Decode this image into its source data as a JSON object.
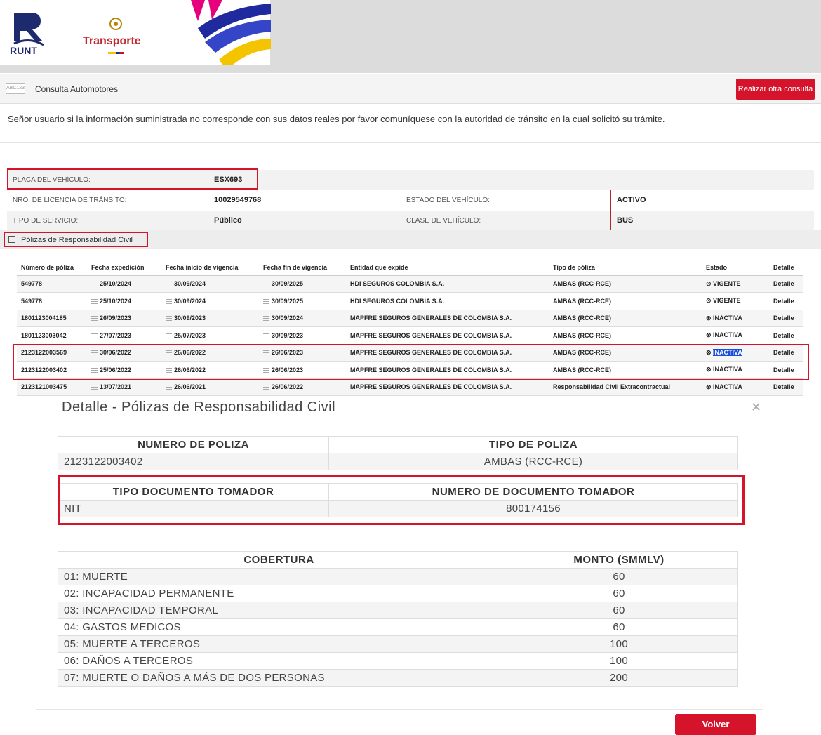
{
  "header": {
    "runt_text": "RUNT",
    "transporte_text": "Transporte"
  },
  "consulta": {
    "icon_text": "ABC123",
    "label": "Consulta Automotores",
    "button": "Realizar otra consulta"
  },
  "notice": "Señor usuario si la información suministrada no corresponde con sus datos reales por favor comuníquese con la autoridad de tránsito en la cual solicitó su trámite.",
  "vehicle": {
    "placa_label": "PLACA DEL VEHÍCULO:",
    "placa": "ESX693",
    "licencia_label": "NRO. DE LICENCIA DE TRÁNSITO:",
    "licencia": "10029549768",
    "estado_label": "ESTADO DEL VEHÍCULO:",
    "estado": "ACTIVO",
    "servicio_label": "TIPO DE SERVICIO:",
    "servicio": "Público",
    "clase_label": "CLASE DE VEHÍCULO:",
    "clase": "BUS"
  },
  "polizas": {
    "section_label": "Pólizas de Responsabilidad Civil",
    "headers": [
      "Número de póliza",
      "Fecha expedición",
      "Fecha inicio de vigencia",
      "Fecha fin de vigencia",
      "Entidad que expide",
      "Tipo de póliza",
      "Estado",
      "Detalle"
    ],
    "rows": [
      [
        "549778",
        "25/10/2024",
        "30/09/2024",
        "30/09/2025",
        "HDI SEGUROS COLOMBIA S.A.",
        "AMBAS (RCC-RCE)",
        "VIGENTE",
        "Detalle"
      ],
      [
        "549778",
        "25/10/2024",
        "30/09/2024",
        "30/09/2025",
        "HDI SEGUROS COLOMBIA S.A.",
        "AMBAS (RCC-RCE)",
        "VIGENTE",
        "Detalle"
      ],
      [
        "1801123004185",
        "26/09/2023",
        "30/09/2023",
        "30/09/2024",
        "MAPFRE SEGUROS GENERALES DE COLOMBIA S.A.",
        "AMBAS (RCC-RCE)",
        "INACTIVA",
        "Detalle"
      ],
      [
        "1801123003042",
        "27/07/2023",
        "25/07/2023",
        "30/09/2023",
        "MAPFRE SEGUROS GENERALES DE COLOMBIA S.A.",
        "AMBAS (RCC-RCE)",
        "INACTIVA",
        "Detalle"
      ],
      [
        "2123122003569",
        "30/06/2022",
        "26/06/2022",
        "26/06/2023",
        "MAPFRE SEGUROS GENERALES DE COLOMBIA S.A.",
        "AMBAS (RCC-RCE)",
        "INACTIVA",
        "Detalle"
      ],
      [
        "2123122003402",
        "25/06/2022",
        "26/06/2022",
        "26/06/2023",
        "MAPFRE SEGUROS GENERALES DE COLOMBIA S.A.",
        "AMBAS (RCC-RCE)",
        "INACTIVA",
        "Detalle"
      ],
      [
        "2123121003475",
        "13/07/2021",
        "26/06/2021",
        "26/06/2022",
        "MAPFRE SEGUROS GENERALES DE COLOMBIA S.A.",
        "Responsabilidad Civil Extracontractual",
        "INACTIVA",
        "Detalle"
      ]
    ]
  },
  "modal": {
    "title": "Detalle - Pólizas de Responsabilidad Civil",
    "close": "✕",
    "poliza_header": "NUMERO DE POLIZA",
    "poliza": "2123122003402",
    "tipo_header": "TIPO DE POLIZA",
    "tipo": "AMBAS (RCC-RCE)",
    "doc_tipo_header": "TIPO DOCUMENTO TOMADOR",
    "doc_tipo": "NIT",
    "doc_num_header": "NUMERO DE DOCUMENTO TOMADOR",
    "doc_num": "800174156",
    "cobertura_header": "COBERTURA",
    "monto_header": "MONTO (SMMLV)",
    "coberturas": [
      [
        "01: MUERTE",
        "60"
      ],
      [
        "02: INCAPACIDAD PERMANENTE",
        "60"
      ],
      [
        "03: INCAPACIDAD TEMPORAL",
        "60"
      ],
      [
        "04: GASTOS MEDICOS",
        "60"
      ],
      [
        "05: MUERTE A TERCEROS",
        "100"
      ],
      [
        "06: DAÑOS A TERCEROS",
        "100"
      ],
      [
        "07: MUERTE O DAÑOS A MÁS DE DOS PERSONAS",
        "200"
      ]
    ],
    "volver": "Volver"
  },
  "colors": {
    "accent": "#d5142b",
    "link": "#2b6cb0",
    "ok": "#3a9d23"
  }
}
